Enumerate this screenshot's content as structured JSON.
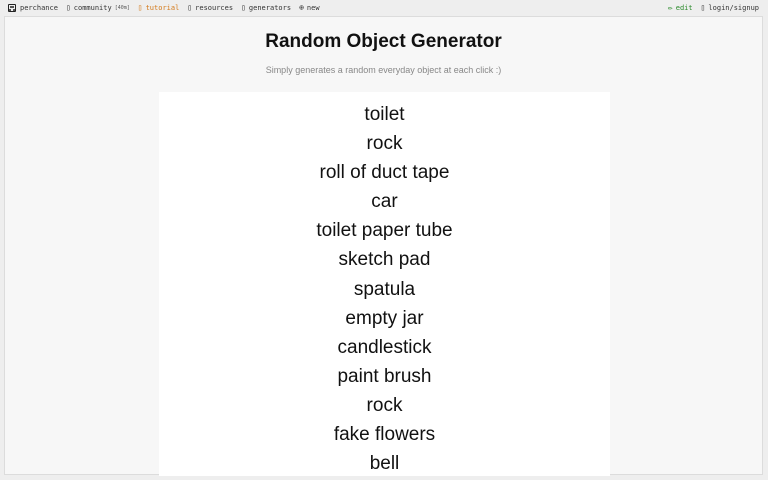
{
  "nav": {
    "left": [
      {
        "name": "nav-perchance",
        "label": "perchance",
        "icon": "dice-icon"
      },
      {
        "name": "nav-community",
        "label": "community",
        "icon": "chat-icon",
        "badge": "[40m]"
      },
      {
        "name": "nav-tutorial",
        "label": "tutorial",
        "icon": "book-icon"
      },
      {
        "name": "nav-resources",
        "label": "resources",
        "icon": "box-icon"
      },
      {
        "name": "nav-generators",
        "label": "generators",
        "icon": "list-icon"
      },
      {
        "name": "nav-new",
        "label": "new",
        "icon": "plus-circle-icon"
      }
    ],
    "right": [
      {
        "name": "nav-edit",
        "label": "edit",
        "icon": "pencil-icon"
      },
      {
        "name": "nav-login",
        "label": "login/signup",
        "icon": "user-icon"
      }
    ]
  },
  "page": {
    "title": "Random Object Generator",
    "subtitle": "Simply generates a random everyday object at each click :)"
  },
  "results": [
    "toilet",
    "rock",
    "roll of duct tape",
    "car",
    "toilet paper tube",
    "sketch pad",
    "spatula",
    "empty jar",
    "candlestick",
    "paint brush",
    "rock",
    "fake flowers",
    "bell"
  ],
  "colors": {
    "accent_tutorial": "#d47a1b",
    "accent_edit": "#2a8a2a",
    "background": "#eeeeee",
    "panel": "#f7f7f7",
    "output": "#ffffff"
  }
}
